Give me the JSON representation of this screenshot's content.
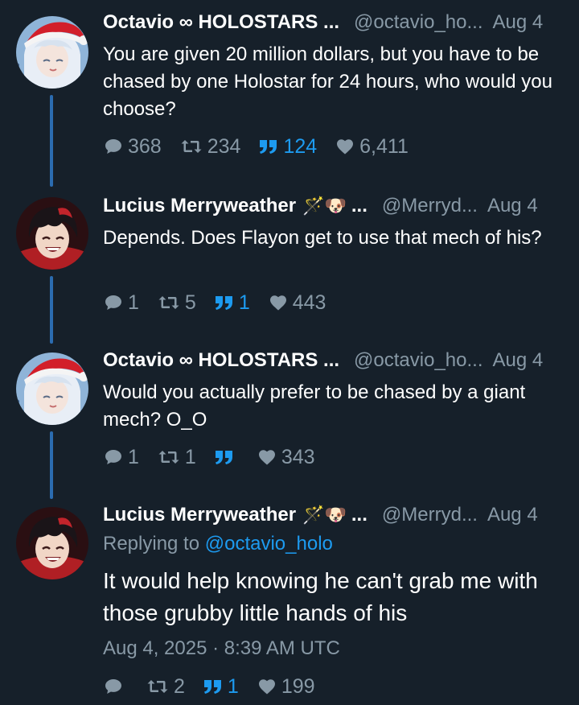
{
  "tweets": [
    {
      "name": "Octavio ∞ HOLOSTARS ...",
      "emoji": "",
      "handle": "@octavio_ho...",
      "date": "Aug 4",
      "text": "You are given 20 million dollars, but you have to be chased by one Holostar for 24 hours, who would you choose?",
      "replies": "368",
      "retweets": "234",
      "quotes": "124",
      "likes": "6,411"
    },
    {
      "name": "Lucius Merryweather",
      "emoji": "🪄🐶",
      "ellipsis": "...",
      "handle": "@Merryd...",
      "date": "Aug 4",
      "text": "Depends. Does Flayon get to use that mech of his?",
      "replies": "1",
      "retweets": "5",
      "quotes": "1",
      "likes": "443"
    },
    {
      "name": "Octavio ∞ HOLOSTARS ...",
      "emoji": "",
      "handle": "@octavio_ho...",
      "date": "Aug 4",
      "text": "Would you actually prefer to be chased by a giant mech? O_O",
      "replies": "1",
      "retweets": "1",
      "quotes": "",
      "likes": "343"
    },
    {
      "name": "Lucius Merryweather",
      "emoji": "🪄🐶",
      "ellipsis": "...",
      "handle": "@Merryd...",
      "date": "Aug 4",
      "replying_label": "Replying to",
      "replying_to": "@octavio_holo",
      "text": "It would help knowing he can't grab me with those grubby little hands of his",
      "timestamp": "Aug 4, 2025 · 8:39 AM UTC",
      "replies": "",
      "retweets": "2",
      "quotes": "1",
      "likes": "199"
    }
  ],
  "icons": {
    "reply": "reply-icon",
    "retweet": "retweet-icon",
    "quote": "quote-icon",
    "like": "heart-icon"
  },
  "colors": {
    "background": "#16202a",
    "thread_line": "#2b6cb0",
    "muted": "#8899a6",
    "accent": "#1d9bf0"
  }
}
